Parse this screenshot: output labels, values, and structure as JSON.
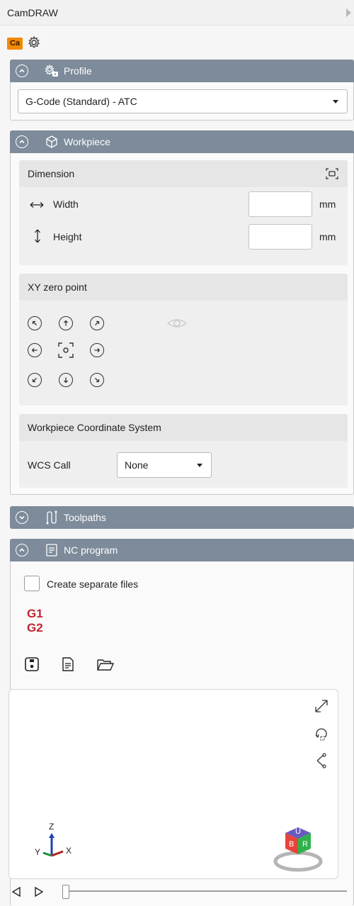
{
  "window": {
    "title": "CamDRAW"
  },
  "toolbar": {
    "logo_text": "Ca"
  },
  "profile": {
    "title": "Profile",
    "selected": "G-Code (Standard) - ATC"
  },
  "workpiece": {
    "title": "Workpiece",
    "dimension": {
      "title": "Dimension",
      "width_label": "Width",
      "width_value": "",
      "height_label": "Height",
      "height_value": "",
      "unit": "mm"
    },
    "xy_zero": {
      "title": "XY zero point"
    },
    "wcs": {
      "title": "Workpiece Coordinate System",
      "call_label": "WCS Call",
      "call_value": "None"
    }
  },
  "toolpaths": {
    "title": "Toolpaths"
  },
  "nc_program": {
    "title": "NC program",
    "separate_files_label": "Create separate files",
    "separate_files_checked": false,
    "gcode_lines": [
      "G1",
      "G2"
    ],
    "axis_labels": {
      "z": "Z",
      "y": "Y",
      "x": "X"
    },
    "cube_faces": {
      "top": "U",
      "left": "B",
      "right": "R"
    }
  },
  "colors": {
    "header_bg": "#7d8b9a",
    "logo_bg": "#f08a00",
    "gcode_red": "#c0262d"
  }
}
